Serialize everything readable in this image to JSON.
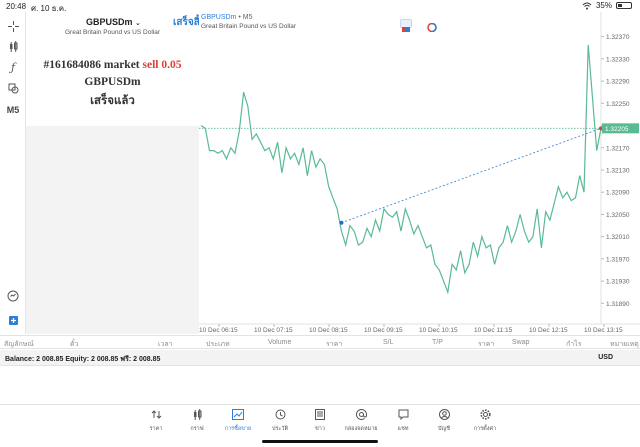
{
  "status_bar": {
    "time": "20:48",
    "date": "ศ. 10 ธ.ค.",
    "battery": "35%",
    "battery_level": 0.35
  },
  "panel": {
    "symbol": "GBPUSDm",
    "description": "Great Britain Pound vs US Dollar",
    "done_label": "เสร็จสิ้น",
    "order_number": "#161684086",
    "order_type": "market",
    "order_side": "sell",
    "order_volume": "0.05",
    "order_symbol": "GBPUSDm",
    "order_status": "เสร็จแล้ว"
  },
  "toolbar": {
    "timeframe": "M5"
  },
  "chart": {
    "title_symbol": "GBPUSDm",
    "title_timeframe": "• M5",
    "subtitle": "Great Britain Pound vs US Dollar",
    "current_price": "1.32205",
    "colors": {
      "line": "#5aba94",
      "price_tag": "#5aba94",
      "entry_dot": "#1c6fd0",
      "exit_dot": "#d9413a"
    }
  },
  "chart_data": {
    "type": "line",
    "y_ticks": [
      "1.32370",
      "1.32330",
      "1.32290",
      "1.32250",
      "1.32210",
      "1.32170",
      "1.32130",
      "1.32090",
      "1.32050",
      "1.32010",
      "1.31970",
      "1.31930",
      "1.31890"
    ],
    "x_ticks": [
      "10 Dec 06:15",
      "10 Dec 07:15",
      "10 Dec 08:15",
      "10 Dec 09:15",
      "10 Dec 10:15",
      "10 Dec 11:15",
      "10 Dec 12:15",
      "10 Dec 13:15"
    ],
    "ylim": [
      1.3186,
      1.324
    ],
    "values": [
      1.3221,
      1.32205,
      1.32165,
      1.32165,
      1.3216,
      1.32165,
      1.3215,
      1.3217,
      1.3216,
      1.322,
      1.3227,
      1.32245,
      1.32185,
      1.32195,
      1.3218,
      1.32165,
      1.3217,
      1.3215,
      1.3218,
      1.32125,
      1.3217,
      1.3215,
      1.3216,
      1.3214,
      1.3217,
      1.3212,
      1.32165,
      1.32135,
      1.3215,
      1.3214,
      1.321,
      1.3208,
      1.3206,
      1.3202,
      1.31995,
      1.3203,
      1.3202,
      1.31995,
      1.32,
      1.32025,
      1.3201,
      1.3204,
      1.3202,
      1.3206,
      1.3205,
      1.32045,
      1.32055,
      1.3202,
      1.3206,
      1.3204,
      1.32015,
      1.3203,
      1.3201,
      1.3199,
      1.31995,
      1.3196,
      1.3195,
      1.3193,
      1.3191,
      1.3196,
      1.3195,
      1.31985,
      1.31945,
      1.3196,
      1.32,
      1.31975,
      1.3201,
      1.3199,
      1.31995,
      1.3196,
      1.3199,
      1.32,
      1.3203,
      1.32,
      1.3202,
      1.3205,
      1.3202,
      1.32,
      1.3201,
      1.3206,
      1.3199,
      1.32055,
      1.3204,
      1.3207,
      1.321,
      1.3208,
      1.3209,
      1.32075,
      1.3208,
      1.3212,
      1.3209,
      1.32355,
      1.3226,
      1.32165,
      1.32205
    ],
    "entry_index": 33,
    "entry_price": 1.32035,
    "current_price": 1.32205
  },
  "positions_header": [
    "สัญลักษณ์",
    "ตั๋ว",
    "เวลา",
    "ประเภท",
    "Volume",
    "ราคา",
    "S/L",
    "T/P",
    "ราคา",
    "Swap",
    "กำไร",
    "หมายเหตุ"
  ],
  "balance": {
    "text": "Balance: 2 008.85 Equity: 2 008.85 ฟรี: 2 008.85",
    "currency": "USD"
  },
  "tabs": [
    {
      "label": "ราคา",
      "icon": "quotes-icon"
    },
    {
      "label": "กราฟ",
      "icon": "chart-candles-icon"
    },
    {
      "label": "การซื้อขาย",
      "icon": "trade-icon"
    },
    {
      "label": "ประวัติ",
      "icon": "history-icon"
    },
    {
      "label": "ข่าว",
      "icon": "news-icon"
    },
    {
      "label": "กล่องจดหมาย",
      "icon": "mailbox-icon"
    },
    {
      "label": "แชท",
      "icon": "chat-icon"
    },
    {
      "label": "บัญชี",
      "icon": "account-icon"
    },
    {
      "label": "การตั้งค่า",
      "icon": "settings-icon"
    }
  ]
}
